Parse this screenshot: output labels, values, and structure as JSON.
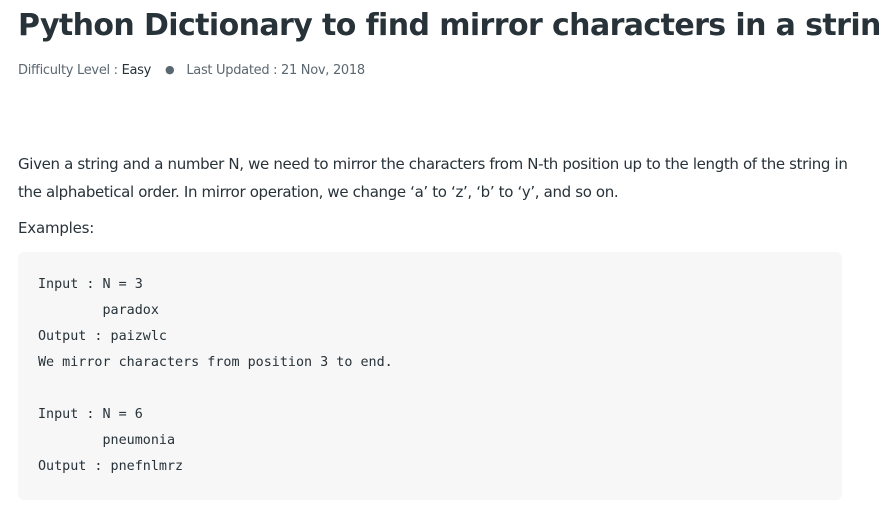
{
  "article": {
    "title": "Python Dictionary to find mirror characters in a string",
    "meta": {
      "difficulty_label": "Difficulty Level : ",
      "difficulty_value": "Easy",
      "separator": "●",
      "updated_label": "Last Updated : 21 Nov, 2018"
    },
    "paragraph": "Given a string and a number N, we need to mirror the characters from N-th position up to the length of the string in the alphabetical order. In mirror operation, we change ‘a’ to ‘z’, ‘b’ to ‘y’, and so on.",
    "examples_label": "Examples:",
    "code": "Input : N = 3\n        paradox\nOutput : paizwlc\nWe mirror characters from position 3 to end.\n\nInput : N = 6\n        pneumonia\nOutput : pnefnlmrz"
  }
}
